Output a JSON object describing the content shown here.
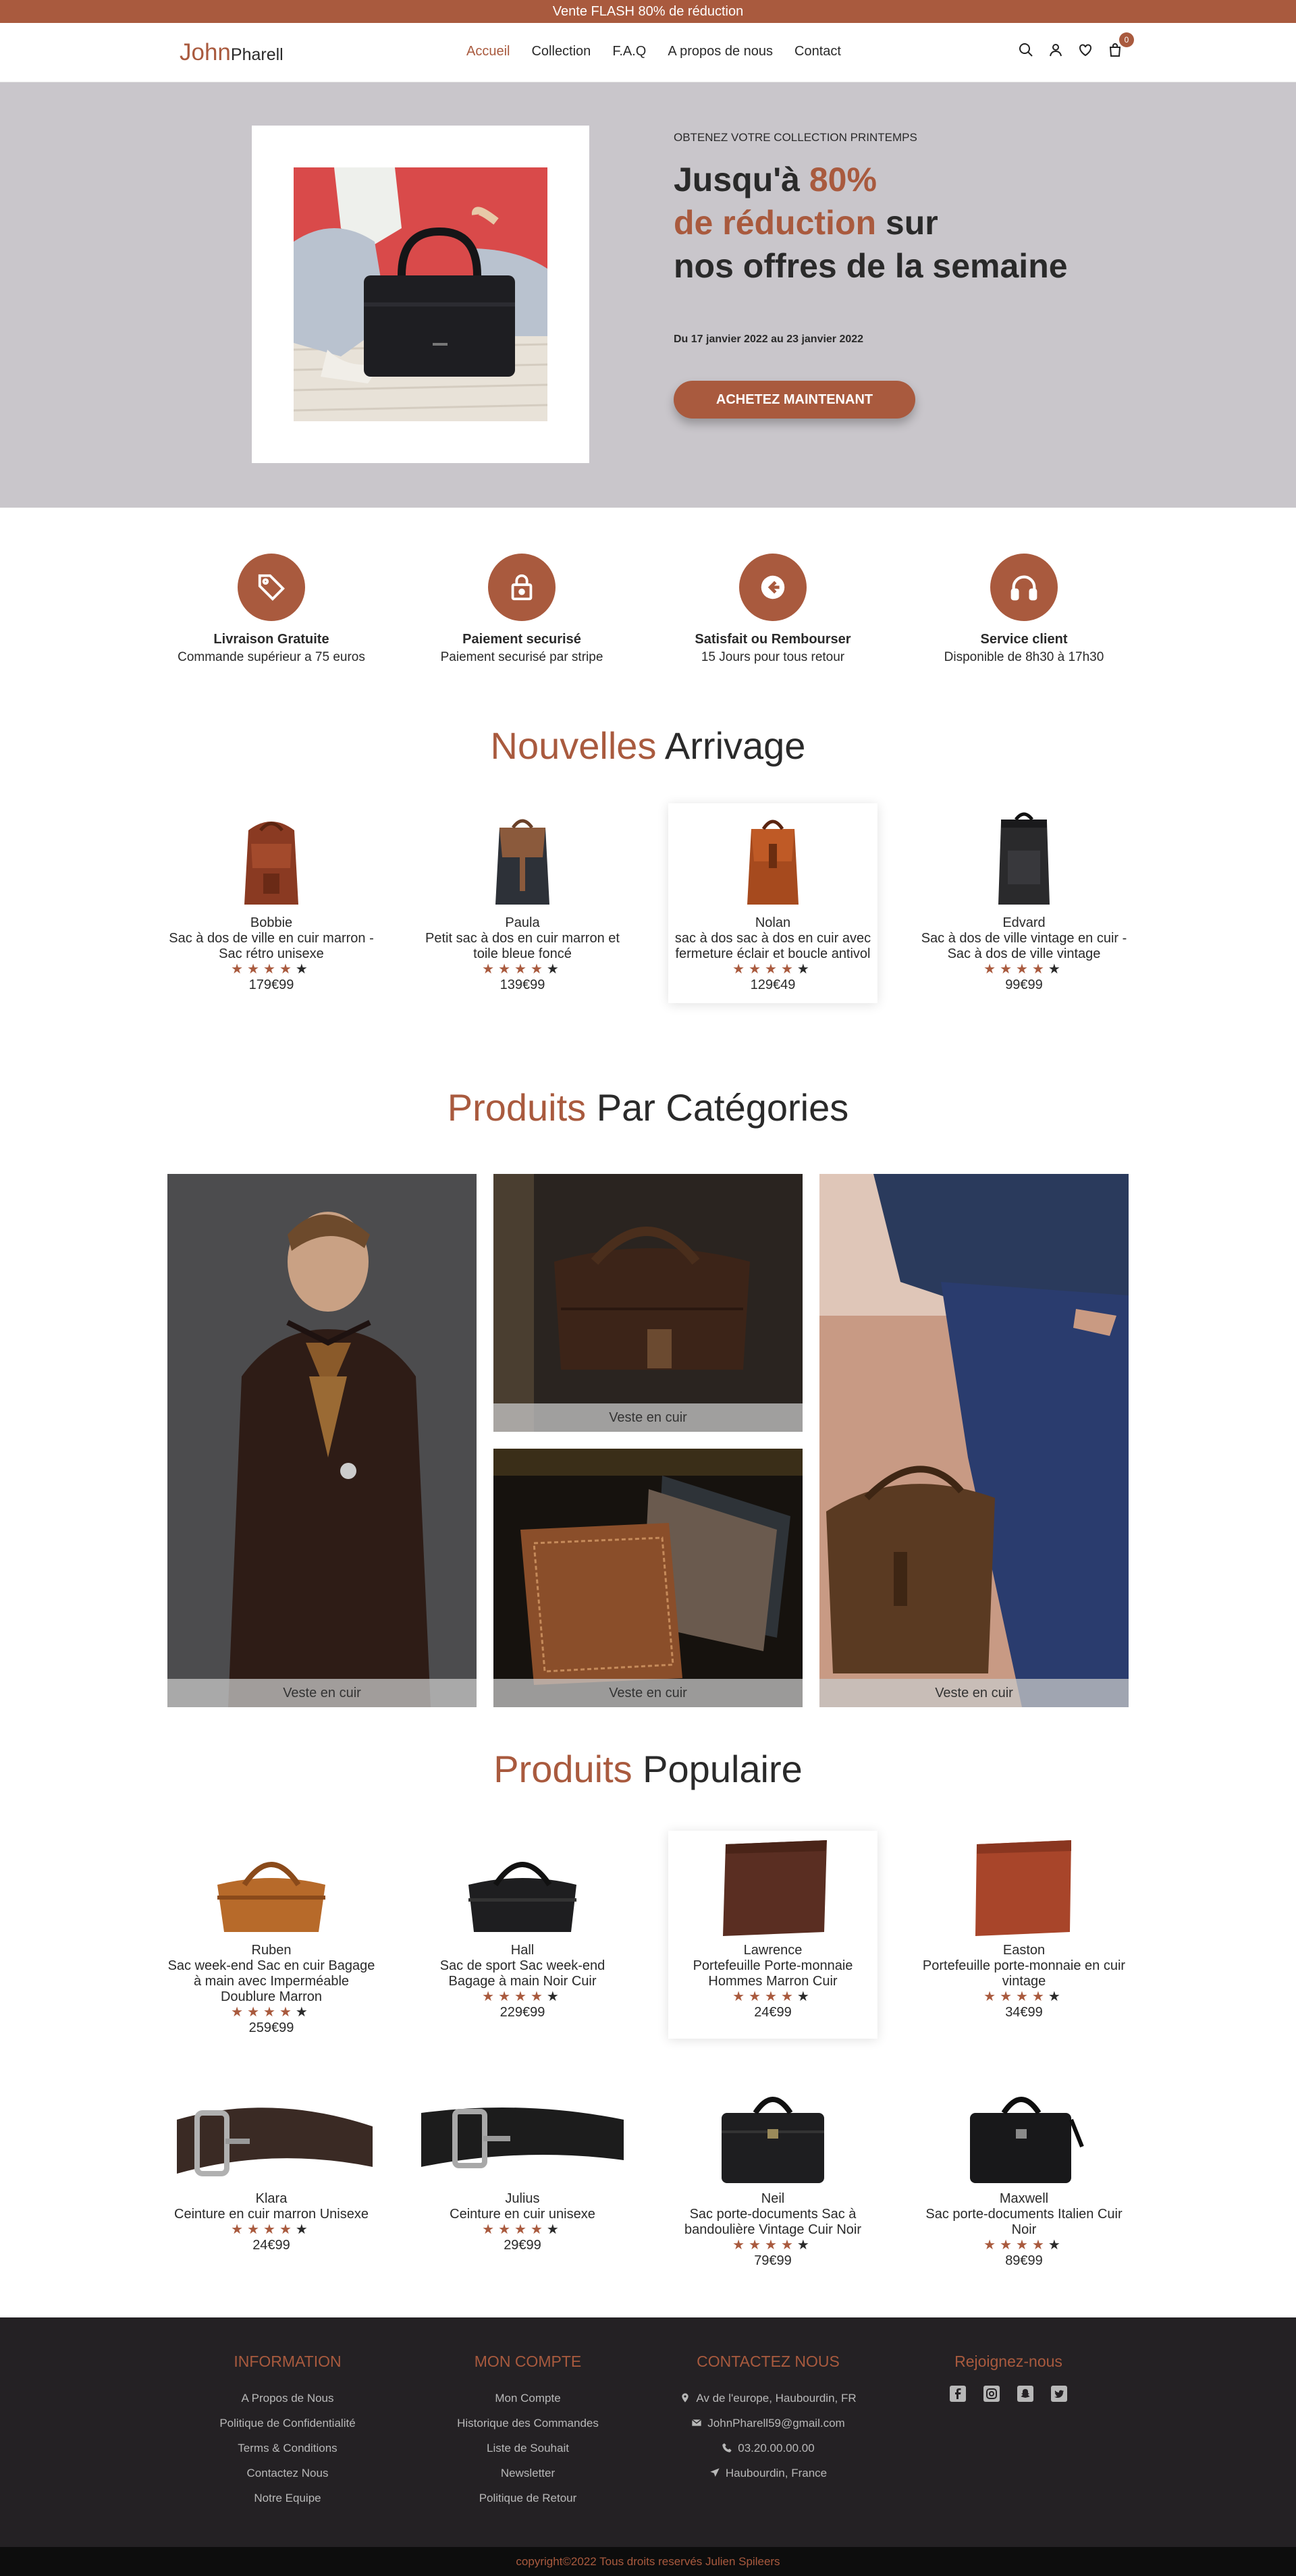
{
  "topbar": {
    "text": "Vente FLASH 80% de réduction"
  },
  "logo": {
    "part1": "John",
    "part2": "Pharell"
  },
  "nav": {
    "items": [
      "Accueil",
      "Collection",
      "F.A.Q",
      "A propos de nous",
      "Contact"
    ]
  },
  "cart": {
    "count": "0"
  },
  "hero": {
    "kicker": "OBTENEZ VOTRE COLLECTION PRINTEMPS",
    "line1a": "Jusqu'à ",
    "line1b": "80%",
    "line2a": "de réduction",
    "line2b": " sur",
    "line3": "nos offres de la semaine",
    "date": "Du 17 janvier 2022 au 23 janvier 2022",
    "button": "ACHETEZ MAINTENANT"
  },
  "features": [
    {
      "icon": "tag-icon",
      "title": "Livraison Gratuite",
      "sub": "Commande supérieur a 75 euros"
    },
    {
      "icon": "lock-icon",
      "title": "Paiement securisé",
      "sub": "Paiement securisé par stripe"
    },
    {
      "icon": "return-icon",
      "title": "Satisfait ou Rembourser",
      "sub": "15 Jours pour tous retour"
    },
    {
      "icon": "headphones-icon",
      "title": "Service client",
      "sub": "Disponible de 8h30 à 17h30"
    }
  ],
  "arrivals": {
    "title_a": "Nouvelles",
    "title_b": " Arrivage",
    "items": [
      {
        "name": "Bobbie",
        "desc": "Sac à dos de ville en cuir marron - Sac rétro unisexe",
        "price": "179€99",
        "rating": 4
      },
      {
        "name": "Paula",
        "desc": "Petit sac à dos en cuir marron et toile bleue foncé",
        "price": "139€99",
        "rating": 4
      },
      {
        "name": "Nolan",
        "desc": "sac à dos sac à dos en cuir avec fermeture éclair et boucle antivol",
        "price": "129€49",
        "rating": 4
      },
      {
        "name": "Edvard",
        "desc": "Sac à dos de ville vintage en cuir - Sac à dos de ville vintage",
        "price": "99€99",
        "rating": 4
      }
    ]
  },
  "categories": {
    "title_a": "Produits",
    "title_b": " Par Catégories",
    "labels": [
      "Veste en cuir",
      "Veste en cuir",
      "Veste en cuir",
      "Veste en cuir"
    ]
  },
  "popular": {
    "title_a": "Produits",
    "title_b": " Populaire",
    "items": [
      {
        "name": "Ruben",
        "desc": "Sac week-end Sac en cuir Bagage à main avec Imperméable Doublure Marron",
        "price": "259€99",
        "rating": 4
      },
      {
        "name": "Hall",
        "desc": "Sac de sport Sac week-end Bagage à main Noir Cuir",
        "price": "229€99",
        "rating": 4
      },
      {
        "name": "Lawrence",
        "desc": "Portefeuille Porte-monnaie Hommes Marron Cuir",
        "price": "24€99",
        "rating": 4
      },
      {
        "name": "Easton",
        "desc": "Portefeuille porte-monnaie en cuir vintage",
        "price": "34€99",
        "rating": 4
      },
      {
        "name": "Klara",
        "desc": "Ceinture en cuir marron Unisexe",
        "price": "24€99",
        "rating": 4
      },
      {
        "name": "Julius",
        "desc": "Ceinture en cuir unisexe",
        "price": "29€99",
        "rating": 4
      },
      {
        "name": "Neil",
        "desc": "Sac porte-documents Sac à bandoulière Vintage Cuir Noir",
        "price": "79€99",
        "rating": 4
      },
      {
        "name": "Maxwell",
        "desc": "Sac porte-documents Italien Cuir Noir",
        "price": "89€99",
        "rating": 4
      }
    ]
  },
  "footer": {
    "info": {
      "title": "INFORMATION",
      "links": [
        "A Propos de Nous",
        "Politique de Confidentialité",
        "Terms & Conditions",
        "Contactez Nous",
        "Notre Equipe"
      ]
    },
    "account": {
      "title": "MON COMPTE",
      "links": [
        "Mon Compte",
        "Historique des Commandes",
        "Liste de Souhait",
        "Newsletter",
        "Politique de Retour"
      ]
    },
    "contact": {
      "title": "CONTACTEZ NOUS",
      "address": "Av de l'europe, Haubourdin, FR",
      "email": "JohnPharell59@gmail.com",
      "phone": "03.20.00.00.00",
      "city": "Haubourdin, France"
    },
    "social": {
      "title": "Rejoignez-nous",
      "icons": [
        "facebook-icon",
        "instagram-icon",
        "snapchat-icon",
        "twitter-icon"
      ]
    }
  },
  "copyright": "copyright©2022 Tous droits reservés Julien Spileers",
  "colors": {
    "accent": "#a95a3e",
    "hero_bg": "#c9c6cb",
    "footer_bg": "#242124"
  }
}
